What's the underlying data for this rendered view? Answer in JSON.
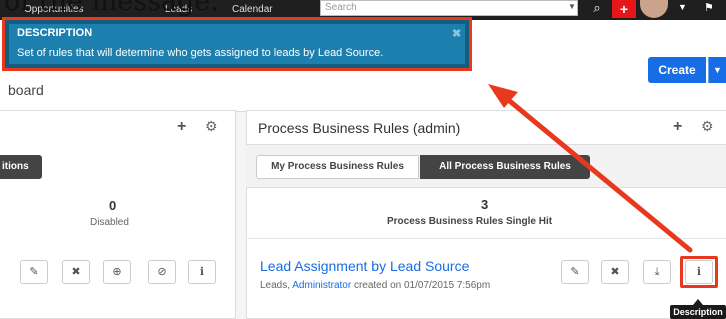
{
  "caption": {
    "text": "of the message."
  },
  "topbar": {
    "nav_1": "Opportunities",
    "nav_2": "Leads",
    "nav_3": "Calendar",
    "search_placeholder": "Search"
  },
  "header": {
    "create_label": "Create",
    "dashboard_partial": "board"
  },
  "description_popup": {
    "title": "DESCRIPTION",
    "body": "Set of rules that will determine who gets assigned to leads by Lead Source."
  },
  "left_dashlet": {
    "tab_partial": "itions",
    "count": "0",
    "count_label": "Disabled"
  },
  "right_dashlet": {
    "title": "Process Business Rules (admin)",
    "tab_mine": "My Process Business Rules",
    "tab_all": "All Process Business Rules",
    "count": "3",
    "count_label": "Process Business Rules Single Hit",
    "record": {
      "name": "Lead Assignment by Lead Source",
      "module": "Leads,",
      "owner": "Administrator",
      "created": "created on 01/07/2015 7:56pm"
    }
  },
  "tooltip": {
    "text": "Description"
  },
  "colors": {
    "accent_red": "#e8391f",
    "popup_blue": "#1d7fae",
    "link_blue": "#176de5"
  }
}
